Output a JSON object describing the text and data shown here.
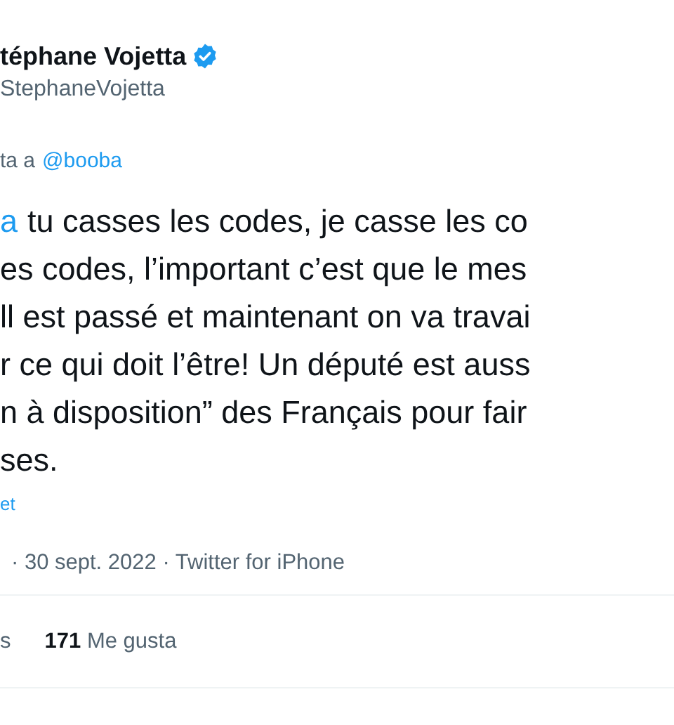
{
  "author": {
    "name": "téphane Vojetta",
    "verified": true,
    "handle": "StephaneVojetta"
  },
  "reply_to": {
    "prefix": "ta a",
    "mention": "@booba"
  },
  "body": {
    "mention_tail": "a",
    "lines": [
      "tu casses les codes, je casse les co",
      "es codes, l’important c’est que le mes",
      "ll est passé et maintenant on va travai",
      "r ce qui doit l’être! Un député est auss",
      "n à disposition” des Français pour fair",
      "ses."
    ]
  },
  "translate_link": "et",
  "meta": "· 30 sept. 2022 · Twitter for iPhone",
  "stats": [
    {
      "label": "s"
    },
    {
      "count": "171",
      "label": "Me gusta"
    }
  ]
}
